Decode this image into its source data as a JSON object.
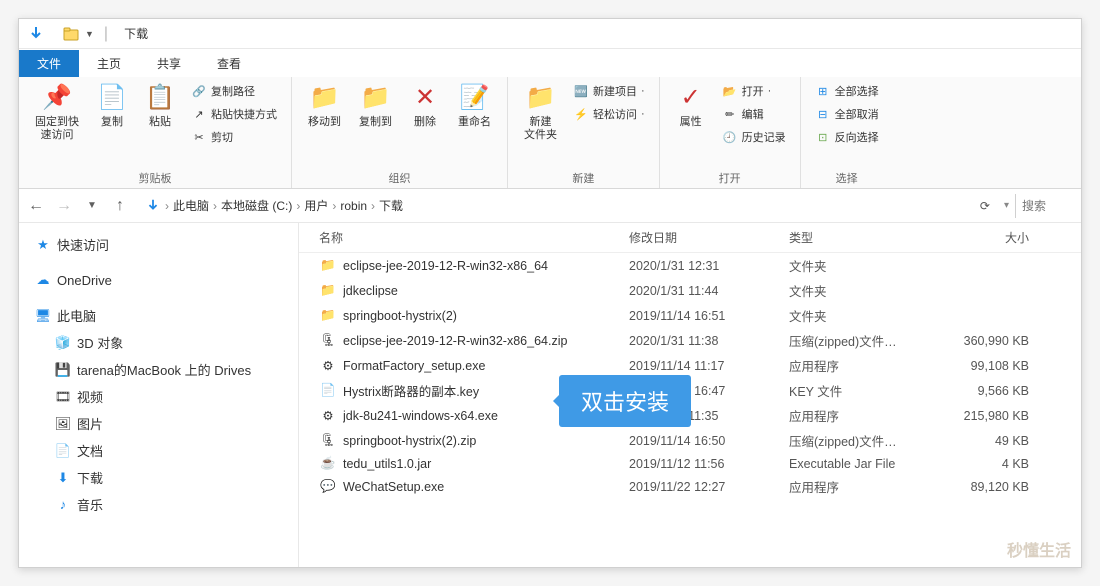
{
  "title": "下载",
  "tabs": {
    "file": "文件",
    "home": "主页",
    "share": "共享",
    "view": "查看"
  },
  "ribbon": {
    "clipboard": {
      "pin": "固定到快\n速访问",
      "copy": "复制",
      "paste": "粘贴",
      "cut": "剪切",
      "copypath": "复制路径",
      "pasteshortcut": "粘贴快捷方式",
      "label": "剪贴板"
    },
    "organize": {
      "moveto": "移动到",
      "copyto": "复制到",
      "delete": "删除",
      "rename": "重命名",
      "label": "组织"
    },
    "new": {
      "newfolder": "新建\n文件夹",
      "newitem": "新建项目",
      "easyaccess": "轻松访问",
      "label": "新建"
    },
    "open": {
      "properties": "属性",
      "open": "打开",
      "edit": "编辑",
      "history": "历史记录",
      "label": "打开"
    },
    "select": {
      "selectall": "全部选择",
      "selectnone": "全部取消",
      "invert": "反向选择",
      "label": "选择"
    }
  },
  "breadcrumb": [
    "此电脑",
    "本地磁盘 (C:)",
    "用户",
    "robin",
    "下载"
  ],
  "search_placeholder": "搜索",
  "sidebar": {
    "quickaccess": "快速访问",
    "onedrive": "OneDrive",
    "thispc": "此电脑",
    "items": [
      "3D 对象",
      "tarena的MacBook  上的 Drives",
      "视频",
      "图片",
      "文档",
      "下载",
      "音乐"
    ]
  },
  "columns": {
    "name": "名称",
    "date": "修改日期",
    "type": "类型",
    "size": "大小"
  },
  "files": [
    {
      "icon": "folder",
      "name": "eclipse-jee-2019-12-R-win32-x86_64",
      "date": "2020/1/31 12:31",
      "type": "文件夹",
      "size": ""
    },
    {
      "icon": "folder",
      "name": "jdkeclipse",
      "date": "2020/1/31 11:44",
      "type": "文件夹",
      "size": ""
    },
    {
      "icon": "folder",
      "name": "springboot-hystrix(2)",
      "date": "2019/11/14 16:51",
      "type": "文件夹",
      "size": ""
    },
    {
      "icon": "zip",
      "name": "eclipse-jee-2019-12-R-win32-x86_64.zip",
      "date": "2020/1/31 11:38",
      "type": "压缩(zipped)文件…",
      "size": "360,990 KB"
    },
    {
      "icon": "exe",
      "name": "FormatFactory_setup.exe",
      "date": "2019/11/14 11:17",
      "type": "应用程序",
      "size": "99,108 KB"
    },
    {
      "icon": "file",
      "name": "Hystrix断路器的副本.key",
      "date": "2019/11/14 16:47",
      "type": "KEY 文件",
      "size": "9,566 KB"
    },
    {
      "icon": "exe",
      "name": "jdk-8u241-windows-x64.exe",
      "date": "2020/1/31 11:35",
      "type": "应用程序",
      "size": "215,980 KB",
      "highlight": true
    },
    {
      "icon": "zip",
      "name": "springboot-hystrix(2).zip",
      "date": "2019/11/14 16:50",
      "type": "压缩(zipped)文件…",
      "size": "49 KB"
    },
    {
      "icon": "jar",
      "name": "tedu_utils1.0.jar",
      "date": "2019/11/12 11:56",
      "type": "Executable Jar File",
      "size": "4 KB"
    },
    {
      "icon": "wechat",
      "name": "WeChatSetup.exe",
      "date": "2019/11/22 12:27",
      "type": "应用程序",
      "size": "89,120 KB"
    }
  ],
  "callout": "双击安装",
  "watermark": "秒懂生活"
}
